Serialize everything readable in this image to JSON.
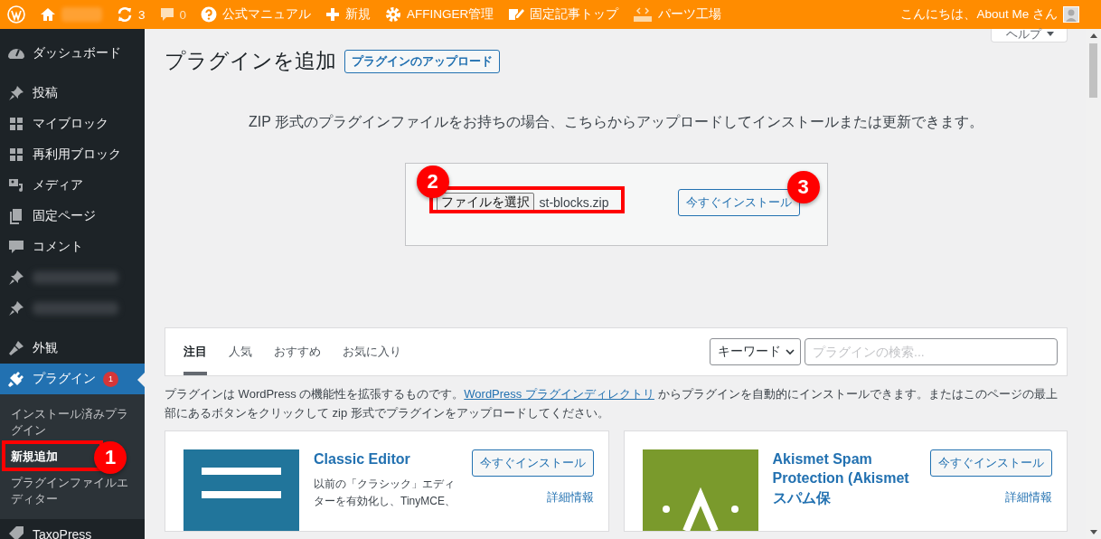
{
  "admin_bar": {
    "items": [
      {
        "kind": "logo"
      },
      {
        "kind": "home"
      },
      {
        "kind": "updates",
        "label": "3"
      },
      {
        "kind": "comments",
        "label": "0"
      },
      {
        "kind": "help",
        "label": "公式マニュアル"
      },
      {
        "kind": "new",
        "label": "新規"
      },
      {
        "kind": "gear",
        "label": "AFFINGER管理"
      },
      {
        "kind": "edit",
        "label": "固定記事トップ"
      },
      {
        "kind": "html",
        "label": "パーツ工場"
      }
    ],
    "greeting": "こんにちは、About Me さん"
  },
  "sidebar": {
    "items": [
      {
        "kind": "dashboard",
        "label": "ダッシュボード",
        "selected": false
      },
      {
        "kind": "pin",
        "label": "投稿",
        "selected": false
      },
      {
        "kind": "grid",
        "label": "マイブロック",
        "selected": false
      },
      {
        "kind": "grid",
        "label": "再利用ブロック",
        "selected": false
      },
      {
        "kind": "media",
        "label": "メディア",
        "selected": false
      },
      {
        "kind": "pages",
        "label": "固定ページ",
        "selected": false
      },
      {
        "kind": "comment",
        "label": "コメント",
        "selected": false
      },
      {
        "kind": "pin",
        "selected": false
      },
      {
        "kind": "pin",
        "selected": false
      },
      {
        "kind": "brush",
        "label": "外観",
        "selected": false
      },
      {
        "kind": "plugin",
        "label": "プラグイン",
        "badge": "1",
        "selected": true,
        "children": [
          {
            "label": "インストール済みプラグイン",
            "selected": false
          },
          {
            "label": "新規追加",
            "selected": true,
            "annotation": "1"
          },
          {
            "label": "プラグインファイルエディター",
            "selected": false
          }
        ]
      },
      {
        "kind": "tag",
        "label": "TaxoPress",
        "selected": false
      }
    ]
  },
  "page": {
    "title": "プラグインを追加",
    "upload_button": "プラグインのアップロード",
    "help_button": "ヘルプ"
  },
  "upload": {
    "description": "ZIP 形式のプラグインファイルをお持ちの場合、こちらからアップロードしてインストールまたは更新できます。",
    "choose_button": "ファイルを選択",
    "file_name": "st-blocks.zip",
    "choose_annotation": "2",
    "install_button": "今すぐインストール",
    "install_annotation": "3"
  },
  "filter": {
    "tabs": [
      {
        "label": "注目",
        "selected": true
      },
      {
        "label": "人気",
        "selected": false
      },
      {
        "label": "おすすめ",
        "selected": false
      },
      {
        "label": "お気に入り",
        "selected": false
      }
    ],
    "search_type": "キーワード",
    "search_placeholder": "プラグインの検索..."
  },
  "intro": {
    "before": "プラグインは WordPress の機能性を拡張するものです。",
    "link": "WordPress プラグインディレクトリ",
    "after": " からプラグインを自動的にインストールできます。またはこのページの最上部にあるボタンをクリックして zip 形式でプラグインをアップロードしてください。"
  },
  "cards": [
    {
      "kind": "classic",
      "name": "Classic Editor",
      "install": "今すぐインストール",
      "details": "詳細情報",
      "description": "以前の「クラシック」エディターを有効化し、TinyMCE、"
    },
    {
      "kind": "akismet",
      "name": "Akismet Spam Protection (Akismet スパム保",
      "install": "今すぐインストール",
      "details": "詳細情報"
    }
  ]
}
